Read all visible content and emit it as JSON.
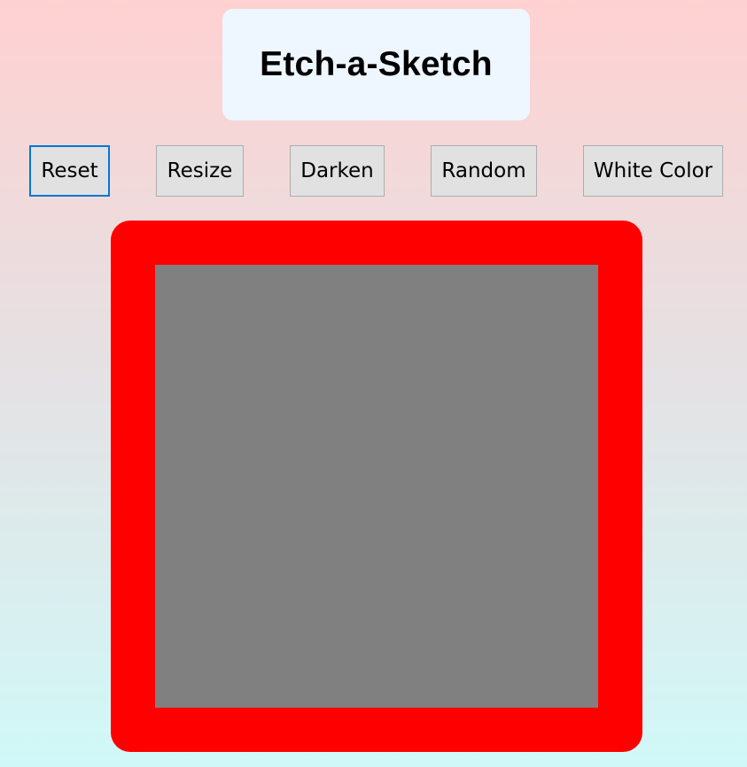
{
  "header": {
    "title": "Etch-a-Sketch"
  },
  "toolbar": {
    "buttons": [
      {
        "label": "Reset"
      },
      {
        "label": "Resize"
      },
      {
        "label": "Darken"
      },
      {
        "label": "Random"
      },
      {
        "label": "White Color"
      }
    ]
  },
  "sketch": {
    "frame_color": "#ff0000",
    "grid_color": "#808080"
  },
  "colors": {
    "background_top": "#ffd1d1",
    "background_bottom": "#d1f8f8",
    "title_card": "#eef6ff",
    "button_bg": "#e1e1e1",
    "focus_border": "#0078d7"
  }
}
